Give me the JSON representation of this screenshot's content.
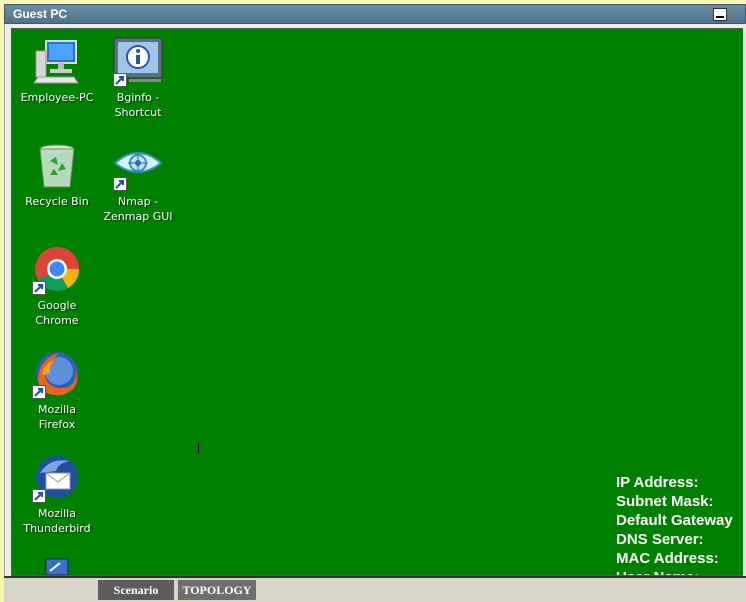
{
  "window": {
    "title": "Guest PC"
  },
  "desktop": {
    "icons": [
      {
        "label": "Employee-PC",
        "icon": "computer-icon"
      },
      {
        "label": "Bginfo -\nShortcut",
        "icon": "bginfo-icon"
      },
      {
        "label": "Recycle Bin",
        "icon": "recycle-bin-icon"
      },
      {
        "label": "Nmap -\nZenmap GUI",
        "icon": "zenmap-icon"
      },
      {
        "label": "Google\nChrome",
        "icon": "chrome-icon"
      },
      {
        "label": "Mozilla\nFirefox",
        "icon": "firefox-icon"
      },
      {
        "label": "Mozilla\nThunderbird",
        "icon": "thunderbird-icon"
      }
    ],
    "bginfo": [
      "IP Address:",
      "Subnet Mask:",
      "Default Gateway",
      "DNS Server:",
      "MAC Address:",
      "User Name:"
    ],
    "background_color": "#008000"
  },
  "tabs": {
    "scenario": "Scenario",
    "topology": "TOPOLOGY"
  }
}
